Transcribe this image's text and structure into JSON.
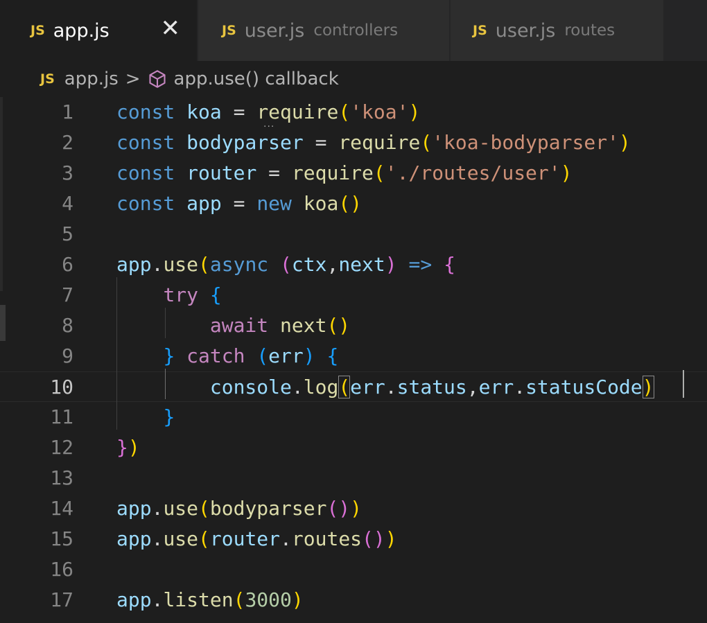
{
  "tabs": [
    {
      "icon": "JS",
      "name": "app.js",
      "desc": "",
      "active": true,
      "close": "✕"
    },
    {
      "icon": "JS",
      "name": "user.js",
      "desc": "controllers",
      "active": false
    },
    {
      "icon": "JS",
      "name": "user.js",
      "desc": "routes",
      "active": false
    }
  ],
  "breadcrumb": {
    "icon": "JS",
    "file": "app.js",
    "separator": ">",
    "symbol_icon": "cube-icon",
    "symbol": "app.use() callback"
  },
  "editor": {
    "current_line": 10,
    "line_numbers": [
      "1",
      "2",
      "3",
      "4",
      "5",
      "6",
      "7",
      "8",
      "9",
      "10",
      "11",
      "12",
      "13",
      "14",
      "15",
      "16",
      "17"
    ],
    "squiggle": "···",
    "lines": [
      [
        [
          "kw",
          "const"
        ],
        [
          "",
          "&nbsp;"
        ],
        [
          "var",
          "koa"
        ],
        [
          "",
          " = "
        ],
        [
          "fn",
          "require"
        ],
        [
          "b1",
          "("
        ],
        [
          "str",
          "'koa'"
        ],
        [
          "b1",
          ")"
        ]
      ],
      [
        [
          "kw",
          "const"
        ],
        [
          "",
          " "
        ],
        [
          "var",
          "bodyparser"
        ],
        [
          "",
          " = "
        ],
        [
          "fn",
          "require"
        ],
        [
          "b1",
          "("
        ],
        [
          "str",
          "'koa-bodyparser'"
        ],
        [
          "b1",
          ")"
        ]
      ],
      [
        [
          "kw",
          "const"
        ],
        [
          "",
          " "
        ],
        [
          "var",
          "router"
        ],
        [
          "",
          " = "
        ],
        [
          "fn",
          "require"
        ],
        [
          "b1",
          "("
        ],
        [
          "str",
          "'./routes/user'"
        ],
        [
          "b1",
          ")"
        ]
      ],
      [
        [
          "kw",
          "const"
        ],
        [
          "",
          " "
        ],
        [
          "var",
          "app"
        ],
        [
          "",
          " = "
        ],
        [
          "kw",
          "new"
        ],
        [
          "",
          " "
        ],
        [
          "fn",
          "koa"
        ],
        [
          "b1",
          "()"
        ]
      ],
      [],
      [
        [
          "var",
          "app"
        ],
        [
          "",
          "."
        ],
        [
          "fn",
          "use"
        ],
        [
          "b1",
          "("
        ],
        [
          "kw",
          "async"
        ],
        [
          "",
          " "
        ],
        [
          "b2",
          "("
        ],
        [
          "var",
          "ctx"
        ],
        [
          "",
          ","
        ],
        [
          "var",
          "next"
        ],
        [
          "b2",
          ")"
        ],
        [
          "",
          " "
        ],
        [
          "kw",
          "=>"
        ],
        [
          "",
          " "
        ],
        [
          "b2",
          "{"
        ]
      ],
      [
        [
          "",
          "    "
        ],
        [
          "ctl",
          "try"
        ],
        [
          "",
          " "
        ],
        [
          "b3",
          "{"
        ]
      ],
      [
        [
          "",
          "        "
        ],
        [
          "ctl",
          "await"
        ],
        [
          "",
          " "
        ],
        [
          "fn",
          "next"
        ],
        [
          "b1",
          "()"
        ]
      ],
      [
        [
          "",
          "    "
        ],
        [
          "b3",
          "}"
        ],
        [
          "",
          " "
        ],
        [
          "ctl",
          "catch"
        ],
        [
          "",
          " "
        ],
        [
          "b3",
          "("
        ],
        [
          "var",
          "err"
        ],
        [
          "b3",
          ")"
        ],
        [
          "",
          " "
        ],
        [
          "b3",
          "{"
        ]
      ],
      [
        [
          "",
          "        "
        ],
        [
          "var",
          "console"
        ],
        [
          "",
          "."
        ],
        [
          "fn",
          "log"
        ],
        [
          "b1m",
          "("
        ],
        [
          "var",
          "err"
        ],
        [
          "",
          "."
        ],
        [
          "var",
          "status"
        ],
        [
          "",
          ","
        ],
        [
          "var",
          "err"
        ],
        [
          "",
          "."
        ],
        [
          "var",
          "statusCode"
        ],
        [
          "b1m",
          ")"
        ]
      ],
      [
        [
          "",
          "    "
        ],
        [
          "b3",
          "}"
        ]
      ],
      [
        [
          "b2",
          "}"
        ],
        [
          "b1",
          ")"
        ]
      ],
      [],
      [
        [
          "var",
          "app"
        ],
        [
          "",
          "."
        ],
        [
          "fn",
          "use"
        ],
        [
          "b1",
          "("
        ],
        [
          "fn",
          "bodyparser"
        ],
        [
          "b2",
          "()"
        ],
        [
          "b1",
          ")"
        ]
      ],
      [
        [
          "var",
          "app"
        ],
        [
          "",
          "."
        ],
        [
          "fn",
          "use"
        ],
        [
          "b1",
          "("
        ],
        [
          "var",
          "router"
        ],
        [
          "",
          "."
        ],
        [
          "fn",
          "routes"
        ],
        [
          "b2",
          "()"
        ],
        [
          "b1",
          ")"
        ]
      ],
      [],
      [
        [
          "var",
          "app"
        ],
        [
          "",
          "."
        ],
        [
          "fn",
          "listen"
        ],
        [
          "b1",
          "("
        ],
        [
          "num",
          "3000"
        ],
        [
          "b1",
          ")"
        ]
      ]
    ]
  }
}
